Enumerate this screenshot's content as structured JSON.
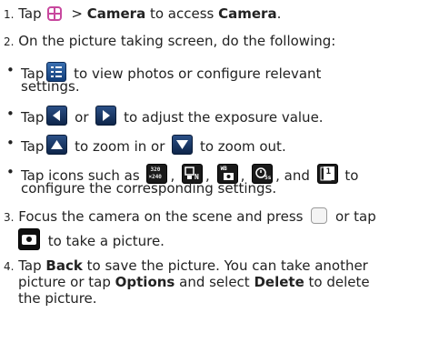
{
  "steps": {
    "s1": {
      "num": "1.",
      "t1": "Tap",
      "t2": " > ",
      "b1": "Camera",
      "t3": " to access ",
      "b2": "Camera",
      "t4": "."
    },
    "s2": {
      "num": "2.",
      "text": "On the picture taking screen, do the following:"
    },
    "b1": {
      "t1": "Tap",
      "t2": " to view photos or configure relevant",
      "t3": "settings."
    },
    "b2": {
      "t1": "Tap",
      "t2": " or ",
      "t3": " to adjust the exposure value."
    },
    "b3": {
      "t1": "Tap",
      "t2": " to zoom in or ",
      "t3": " to zoom out."
    },
    "b4": {
      "t1": "Tap icons such as ",
      "t2": ", ",
      "t3": ", ",
      "t4": ", ",
      "t5": ", and ",
      "t6": " to",
      "t7": "configure the corresponding settings."
    },
    "s3": {
      "num": "3.",
      "t1": "Focus the camera on the scene and press ",
      "t2": " or tap",
      "t3": " to take a picture."
    },
    "s4": {
      "num": "4.",
      "t1": "Tap ",
      "b1": "Back",
      "t2": " to save the picture. You can take another",
      "t3": "picture or tap ",
      "b2": "Options",
      "t4": " and select ",
      "b3": "Delete",
      "t5": " to delete",
      "t6": "the picture."
    }
  },
  "icons": {
    "wb_text": "WB",
    "res_text_top": "320",
    "res_text_bot": "×240",
    "scene_text": "N",
    "timer_text": "5s",
    "burst_text": "1"
  }
}
